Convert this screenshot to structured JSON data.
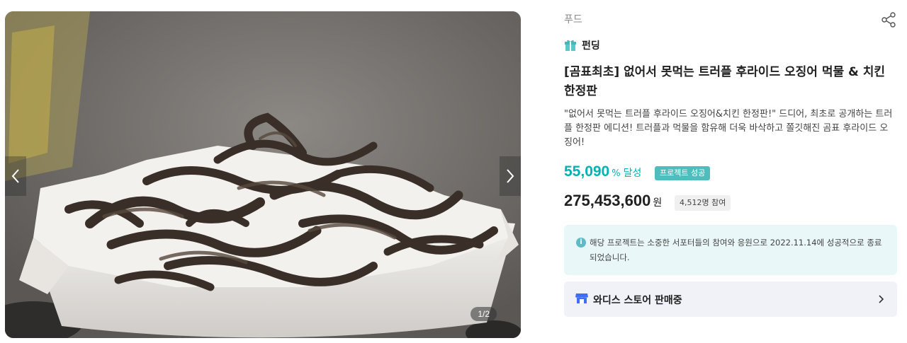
{
  "gallery": {
    "counter": "1/2",
    "prev_icon": "chevron-left-icon",
    "next_icon": "chevron-right-icon"
  },
  "product": {
    "category": "푸드",
    "funding_label": "펀딩",
    "funding_icon": "gift-icon",
    "share_icon": "share-icon",
    "title": "[곰표최초] 없어서 못먹는 트러플 후라이드 오징어 먹물 & 치킨 한정판",
    "description": "\"없어서 못먹는 트러플 후라이드 오징어&치킨 한정판!\" 드디어, 최초로 공개하는 트러플 한정판 에디션! 트러플과 먹물을 함유해 더욱 바삭하고 쫄깃해진 곰표 후라이드 오징어!",
    "achievement_rate": "55,090",
    "achievement_unit": "%",
    "achievement_label": "달성",
    "status_badge": "프로젝트 성공",
    "amount": "275,453,600",
    "amount_unit": "원",
    "participants": "4,512명 참여"
  },
  "notice": {
    "icon": "info-icon",
    "text": "해당 프로젝트는 소중한 서포터들의 참여와 응원으로 2022.11.14에 성공적으로 종료되었습니다."
  },
  "store": {
    "icon": "store-icon",
    "label": "와디스 스토어 판매중",
    "chevron_icon": "chevron-right-icon"
  },
  "colors": {
    "accent": "#00b2b2",
    "badge": "#4fbdbd",
    "notice_bg": "#e9f7f8",
    "store_bg": "#f0f2f8",
    "store_icon": "#3d6ef5"
  }
}
